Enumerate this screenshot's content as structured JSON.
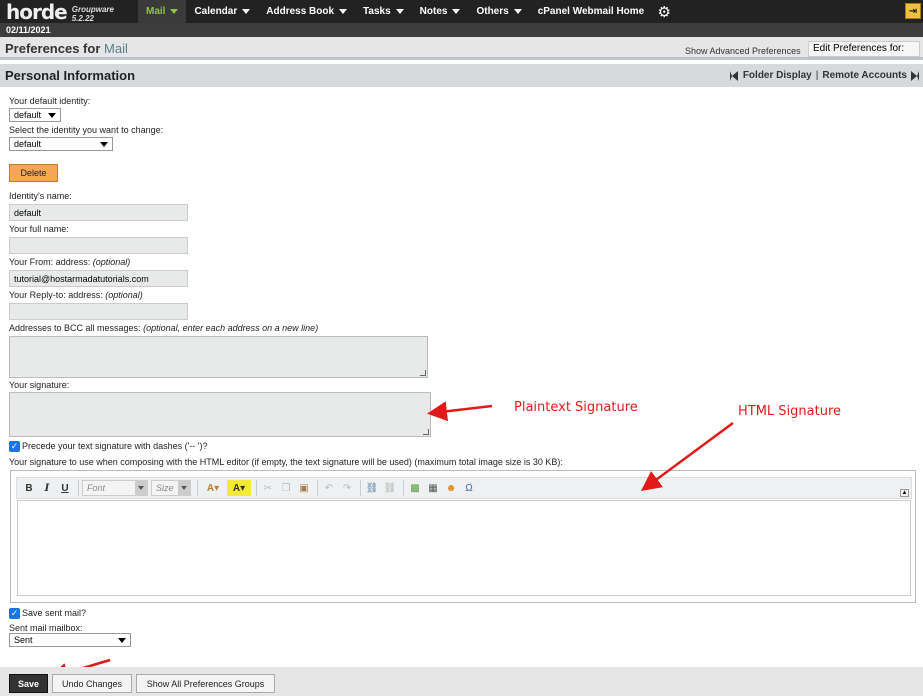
{
  "header": {
    "brand": "horde",
    "version": "Groupware 5.2.22",
    "nav": [
      "Mail",
      "Calendar",
      "Address Book",
      "Tasks",
      "Notes",
      "Others",
      "cPanel Webmail Home"
    ],
    "date": "02/11/2021"
  },
  "title": {
    "prefix": "Preferences for",
    "app": "Mail"
  },
  "advanced_link": "Show Advanced Preferences",
  "edit_prefs_label": "Edit Preferences for:",
  "section": {
    "title": "Personal Information",
    "folder_display": "Folder Display",
    "separator": "|",
    "remote_accounts": "Remote Accounts"
  },
  "form": {
    "default_identity_label": "Your default identity:",
    "default_identity_value": "default",
    "select_identity_label": "Select the identity you want to change:",
    "select_identity_value": "default",
    "delete_label": "Delete",
    "identity_name_label": "Identity's name:",
    "identity_name_value": "default",
    "full_name_label": "Your full name:",
    "full_name_value": "",
    "from_label": "Your From: address:",
    "from_optional": "(optional)",
    "from_value": "tutorial@hostarmadatutorials.com",
    "replyto_label": "Your Reply-to: address:",
    "replyto_optional": "(optional)",
    "replyto_value": "",
    "bcc_label": "Addresses to BCC all messages:",
    "bcc_optional": "(optional, enter each address on a new line)",
    "signature_label": "Your signature:",
    "dashes_label": "Precede your text signature with dashes ('-- ')?",
    "html_sig_label": "Your signature to use when composing with the HTML editor (if empty, the text signature will be used) (maximum total image size is 30 KB):",
    "save_sent_label": "Save sent mail?",
    "sent_mailbox_label": "Sent mail mailbox:",
    "sent_mailbox_value": "Sent"
  },
  "editor": {
    "bold": "B",
    "italic": "I",
    "underline": "U",
    "font_placeholder": "Font",
    "size_placeholder": "Size"
  },
  "annotations": {
    "plaintext": "Plaintext Signature",
    "html": "HTML Signature"
  },
  "buttons": {
    "save": "Save",
    "undo": "Undo Changes",
    "show_all": "Show All Preferences Groups"
  },
  "colors": {
    "accent_green": "#8fc63d",
    "annotation_red": "#e21a1a",
    "delete_orange": "#f5a754"
  }
}
